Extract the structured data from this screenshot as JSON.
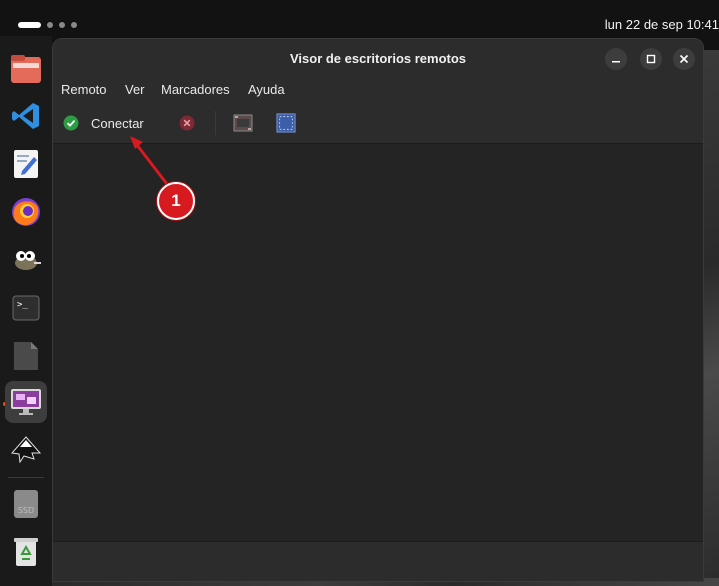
{
  "topbar": {
    "clock": "lun 22 de sep  10:41"
  },
  "dock": {
    "items": [
      {
        "name": "files-icon"
      },
      {
        "name": "vscode-icon"
      },
      {
        "name": "text-editor-icon"
      },
      {
        "name": "firefox-icon"
      },
      {
        "name": "gimp-icon"
      },
      {
        "name": "terminal-icon"
      },
      {
        "name": "libreoffice-icon"
      },
      {
        "name": "remote-desktop-viewer-icon",
        "active": true
      },
      {
        "name": "inkscape-icon"
      },
      {
        "name": "ssd-drive-icon",
        "label": "SSD"
      },
      {
        "name": "trash-icon"
      }
    ]
  },
  "window": {
    "title": "Visor de escritorios remotos",
    "menu": [
      "Remoto",
      "Ver",
      "Marcadores",
      "Ayuda"
    ],
    "toolbar": {
      "connect_label": "Conectar"
    }
  },
  "annotation": {
    "badge": "1",
    "color": "#d71920"
  }
}
